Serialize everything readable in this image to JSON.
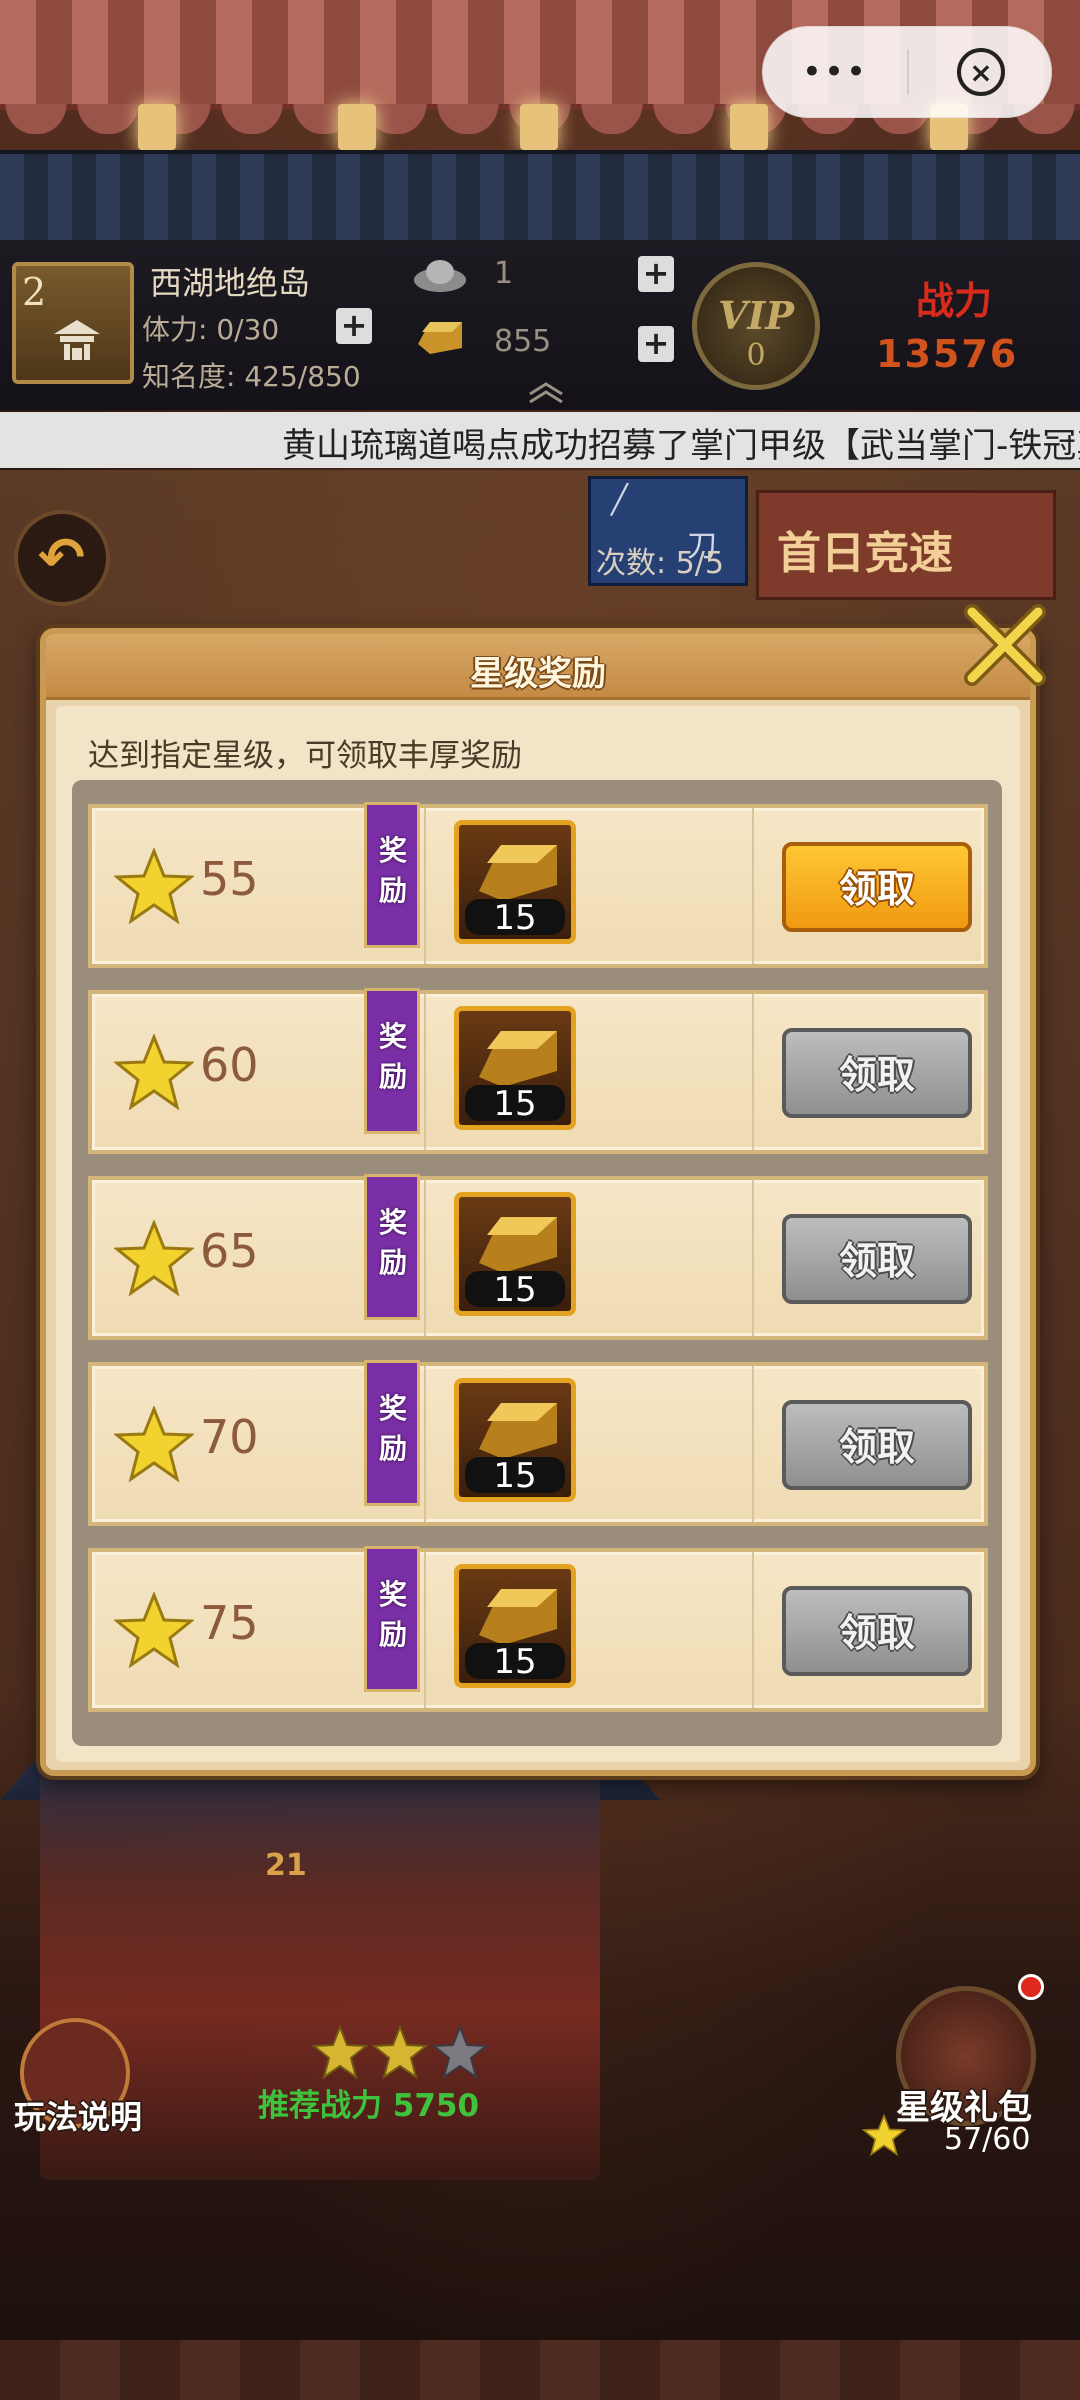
{
  "capsule": {
    "more_label": "•••",
    "close_label": "×"
  },
  "player": {
    "level": "2",
    "location": "西湖地绝岛",
    "stamina": "体力: 0/30",
    "fame": "知名度: 425/850",
    "silver": "1",
    "gold": "855",
    "vip_label": "VIP",
    "vip_level": "0",
    "power_label": "战力",
    "power_value": "13576"
  },
  "marquee": {
    "text": "黄山琉璃道喝点成功招募了掌门甲级【武当掌门-铁冠真"
  },
  "scene": {
    "count_label": "次数: 5/5",
    "dao_label": "刀",
    "banner_text": "首日竞速",
    "stage_number": "21",
    "recommended_power": "推荐战力 5750",
    "stage_stars_earned": 2,
    "stage_stars_total": 3
  },
  "dialog": {
    "title": "星级奖励",
    "description": "达到指定星级，可领取丰厚奖励",
    "reward_tag": "奖励",
    "claim_label": "领取",
    "rows": [
      {
        "stars": "55",
        "qty": "15",
        "claimable": true
      },
      {
        "stars": "60",
        "qty": "15",
        "claimable": false
      },
      {
        "stars": "65",
        "qty": "15",
        "claimable": false
      },
      {
        "stars": "70",
        "qty": "15",
        "claimable": false
      },
      {
        "stars": "75",
        "qty": "15",
        "claimable": false
      }
    ]
  },
  "bottom": {
    "help_label": "玩法说明",
    "gift_label": "星级礼包",
    "gift_progress": "57/60"
  },
  "colors": {
    "accent_gold": "#f09a10",
    "tag_purple": "#7b2fa6",
    "power_red": "#d92b1c",
    "recommend_green": "#3fc23c"
  }
}
